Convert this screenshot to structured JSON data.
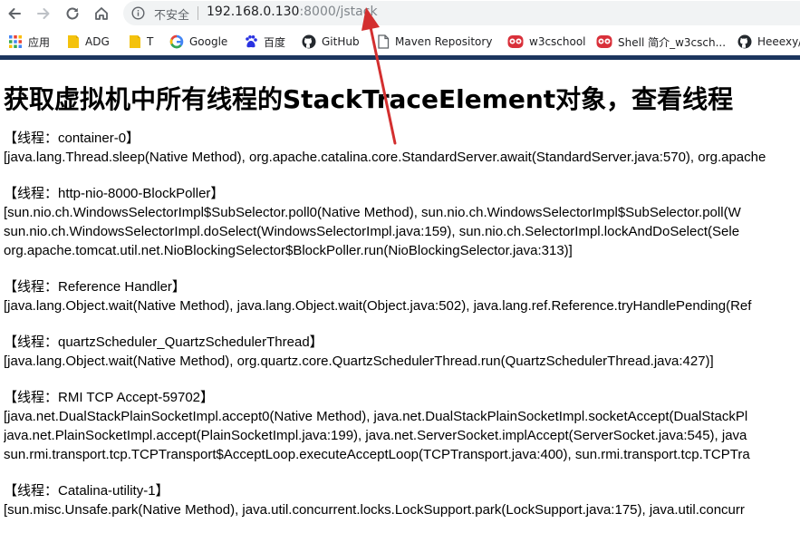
{
  "browser": {
    "insecure_label": "不安全",
    "url_host": "192.168.0.130",
    "url_rest": ":8000/jstack"
  },
  "bookmarks": [
    {
      "label": "应用",
      "icon": "apps-grid-icon"
    },
    {
      "label": "ADG",
      "icon": "folder-icon"
    },
    {
      "label": "T",
      "icon": "folder-icon"
    },
    {
      "label": "Google",
      "icon": "google-icon"
    },
    {
      "label": "百度",
      "icon": "baidu-paw-icon"
    },
    {
      "label": "GitHub",
      "icon": "github-icon"
    },
    {
      "label": "Maven Repository",
      "icon": "page-icon"
    },
    {
      "label": "w3cschool",
      "icon": "w3cschool-icon"
    },
    {
      "label": "Shell 简介_w3csch...",
      "icon": "w3cschool-icon"
    },
    {
      "label": "Heeexy/",
      "icon": "github-icon"
    }
  ],
  "page": {
    "title": "获取虚拟机中所有线程的StackTraceElement对象，查看线程",
    "threads": [
      {
        "name": "【线程：container-0】",
        "lines": [
          "[java.lang.Thread.sleep(Native Method), org.apache.catalina.core.StandardServer.await(StandardServer.java:570), org.apache"
        ]
      },
      {
        "name": "【线程：http-nio-8000-BlockPoller】",
        "lines": [
          "[sun.nio.ch.WindowsSelectorImpl$SubSelector.poll0(Native Method), sun.nio.ch.WindowsSelectorImpl$SubSelector.poll(W",
          "sun.nio.ch.WindowsSelectorImpl.doSelect(WindowsSelectorImpl.java:159), sun.nio.ch.SelectorImpl.lockAndDoSelect(Sele",
          "org.apache.tomcat.util.net.NioBlockingSelector$BlockPoller.run(NioBlockingSelector.java:313)]"
        ]
      },
      {
        "name": "【线程：Reference Handler】",
        "lines": [
          "[java.lang.Object.wait(Native Method), java.lang.Object.wait(Object.java:502), java.lang.ref.Reference.tryHandlePending(Ref"
        ]
      },
      {
        "name": "【线程：quartzScheduler_QuartzSchedulerThread】",
        "lines": [
          "[java.lang.Object.wait(Native Method), org.quartz.core.QuartzSchedulerThread.run(QuartzSchedulerThread.java:427)]"
        ]
      },
      {
        "name": "【线程：RMI TCP Accept-59702】",
        "lines": [
          "[java.net.DualStackPlainSocketImpl.accept0(Native Method), java.net.DualStackPlainSocketImpl.socketAccept(DualStackPl",
          "java.net.PlainSocketImpl.accept(PlainSocketImpl.java:199), java.net.ServerSocket.implAccept(ServerSocket.java:545), java",
          "sun.rmi.transport.tcp.TCPTransport$AcceptLoop.executeAcceptLoop(TCPTransport.java:400), sun.rmi.transport.tcp.TCPTra"
        ]
      },
      {
        "name": "【线程：Catalina-utility-1】",
        "lines": [
          "[sun.misc.Unsafe.park(Native Method), java.util.concurrent.locks.LockSupport.park(LockSupport.java:175), java.util.concurr"
        ]
      }
    ]
  },
  "colors": {
    "annotation_arrow": "#d32f2f",
    "bookmark_strip": "#1c355e",
    "w3c_red": "#d9303a",
    "folder_yellow": "#f4c20d"
  }
}
